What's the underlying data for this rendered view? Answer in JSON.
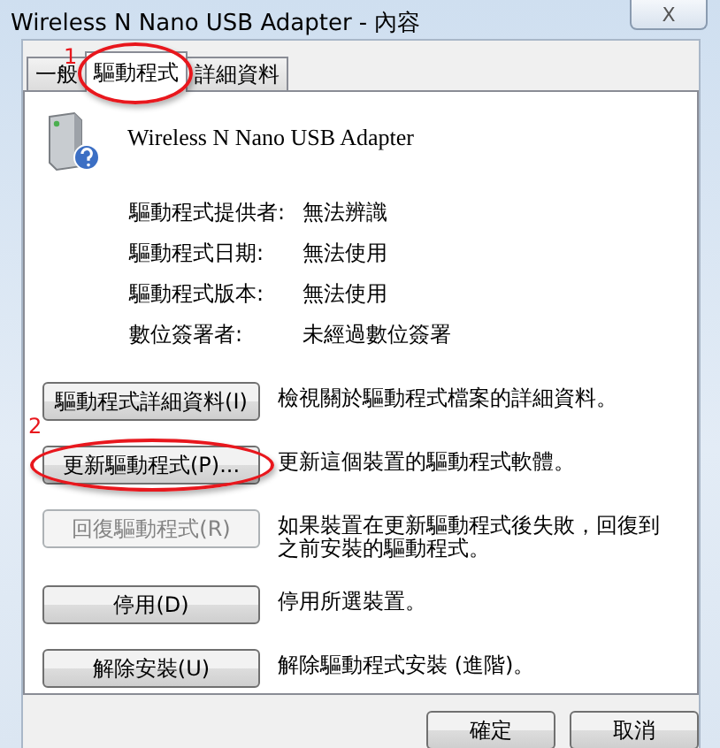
{
  "window": {
    "title": "Wireless N Nano USB Adapter - 內容",
    "close": "X"
  },
  "tabs": [
    {
      "label": "一般",
      "selected": false
    },
    {
      "label": "驅動程式",
      "selected": true,
      "annotation": "1"
    },
    {
      "label": "詳細資料",
      "selected": false
    }
  ],
  "device": {
    "name": "Wireless N Nano USB Adapter"
  },
  "info": [
    {
      "label": "驅動程式提供者:",
      "value": "無法辨識"
    },
    {
      "label": "驅動程式日期:",
      "value": "無法使用"
    },
    {
      "label": "驅動程式版本:",
      "value": "無法使用"
    },
    {
      "label": "數位簽署者:",
      "value": "未經過數位簽署"
    }
  ],
  "actions": [
    {
      "button": "驅動程式詳細資料(I)",
      "description": "檢視關於驅動程式檔案的詳細資料。",
      "disabled": false
    },
    {
      "button": "更新驅動程式(P)...",
      "description": "更新這個裝置的驅動程式軟體。",
      "disabled": false,
      "annotation": "2"
    },
    {
      "button": "回復驅動程式(R)",
      "description": "如果裝置在更新驅動程式後失敗，回復到之前安裝的驅動程式。",
      "disabled": true
    },
    {
      "button": "停用(D)",
      "description": "停用所選裝置。",
      "disabled": false
    },
    {
      "button": "解除安裝(U)",
      "description": "解除驅動程式安裝 (進階)。",
      "disabled": false
    }
  ],
  "buttons": [
    "確定",
    "取消"
  ]
}
